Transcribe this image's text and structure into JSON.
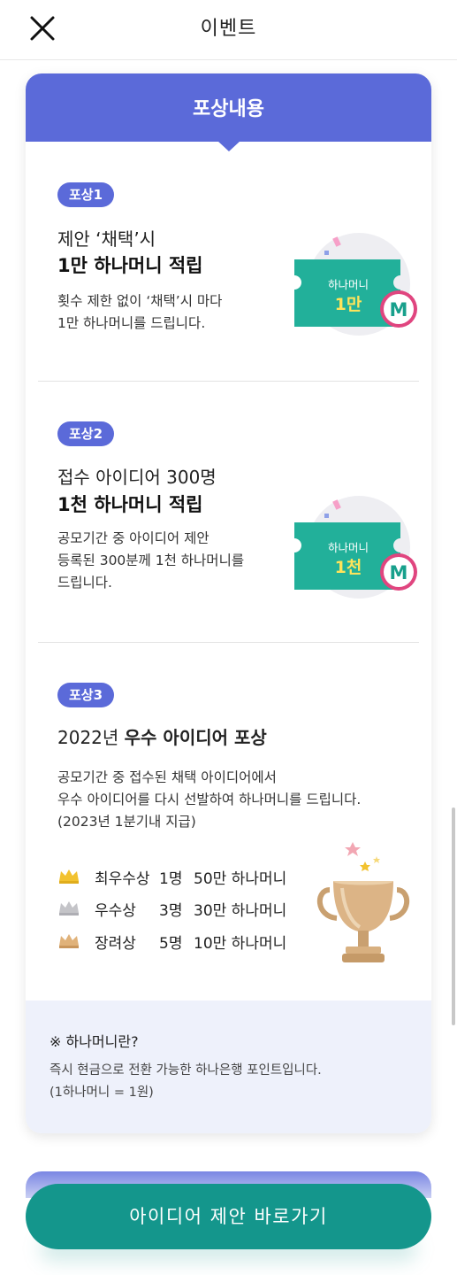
{
  "header": {
    "title": "이벤트",
    "close_icon": "close-icon"
  },
  "card": {
    "title": "포상내용",
    "accent_color": "#5b6ad9",
    "prizes": [
      {
        "badge": "포상1",
        "line1": "제안 ‘채택’시",
        "line2": "1만 하나머니 적립",
        "desc": [
          "횟수 제한 없이 ‘채택’시 마다",
          "1만 하나머니를 드립니다."
        ],
        "ticket_label": "하나머니",
        "ticket_value": "1만"
      },
      {
        "badge": "포상2",
        "line1": "접수 아이디어 300명",
        "line2": "1천 하나머니 적립",
        "desc": [
          "공모기간 중 아이디어 제안",
          "등록된 300분께 1천 하나머니를",
          "드립니다."
        ],
        "ticket_label": "하나머니",
        "ticket_value": "1천"
      },
      {
        "badge": "포상3",
        "line_prefix": "2022년 ",
        "line_bold": "우수 아이디어 포상",
        "desc": [
          "공모기간 중 접수된 채택 아이디어에서",
          "우수 아이디어를 다시 선발하여 하나머니를 드립니다.",
          "(2023년 1분기내 지급)"
        ],
        "awards": [
          {
            "name": "최우수상",
            "count": "1명",
            "amount": "50만 하나머니",
            "crown": "gold"
          },
          {
            "name": "우수상",
            "count": "3명",
            "amount": "30만 하나머니",
            "crown": "silver"
          },
          {
            "name": "장려상",
            "count": "5명",
            "amount": "10만 하나머니",
            "crown": "bronze"
          }
        ]
      }
    ],
    "note": {
      "title": "※ 하나머니란?",
      "desc": [
        "즉시 현금으로 전환 가능한 하나은행 포인트입니다.",
        "(1하나머니 = 1원)"
      ]
    }
  },
  "cta": {
    "label": "아이디어 제안 바로가기",
    "color": "#14968c"
  }
}
